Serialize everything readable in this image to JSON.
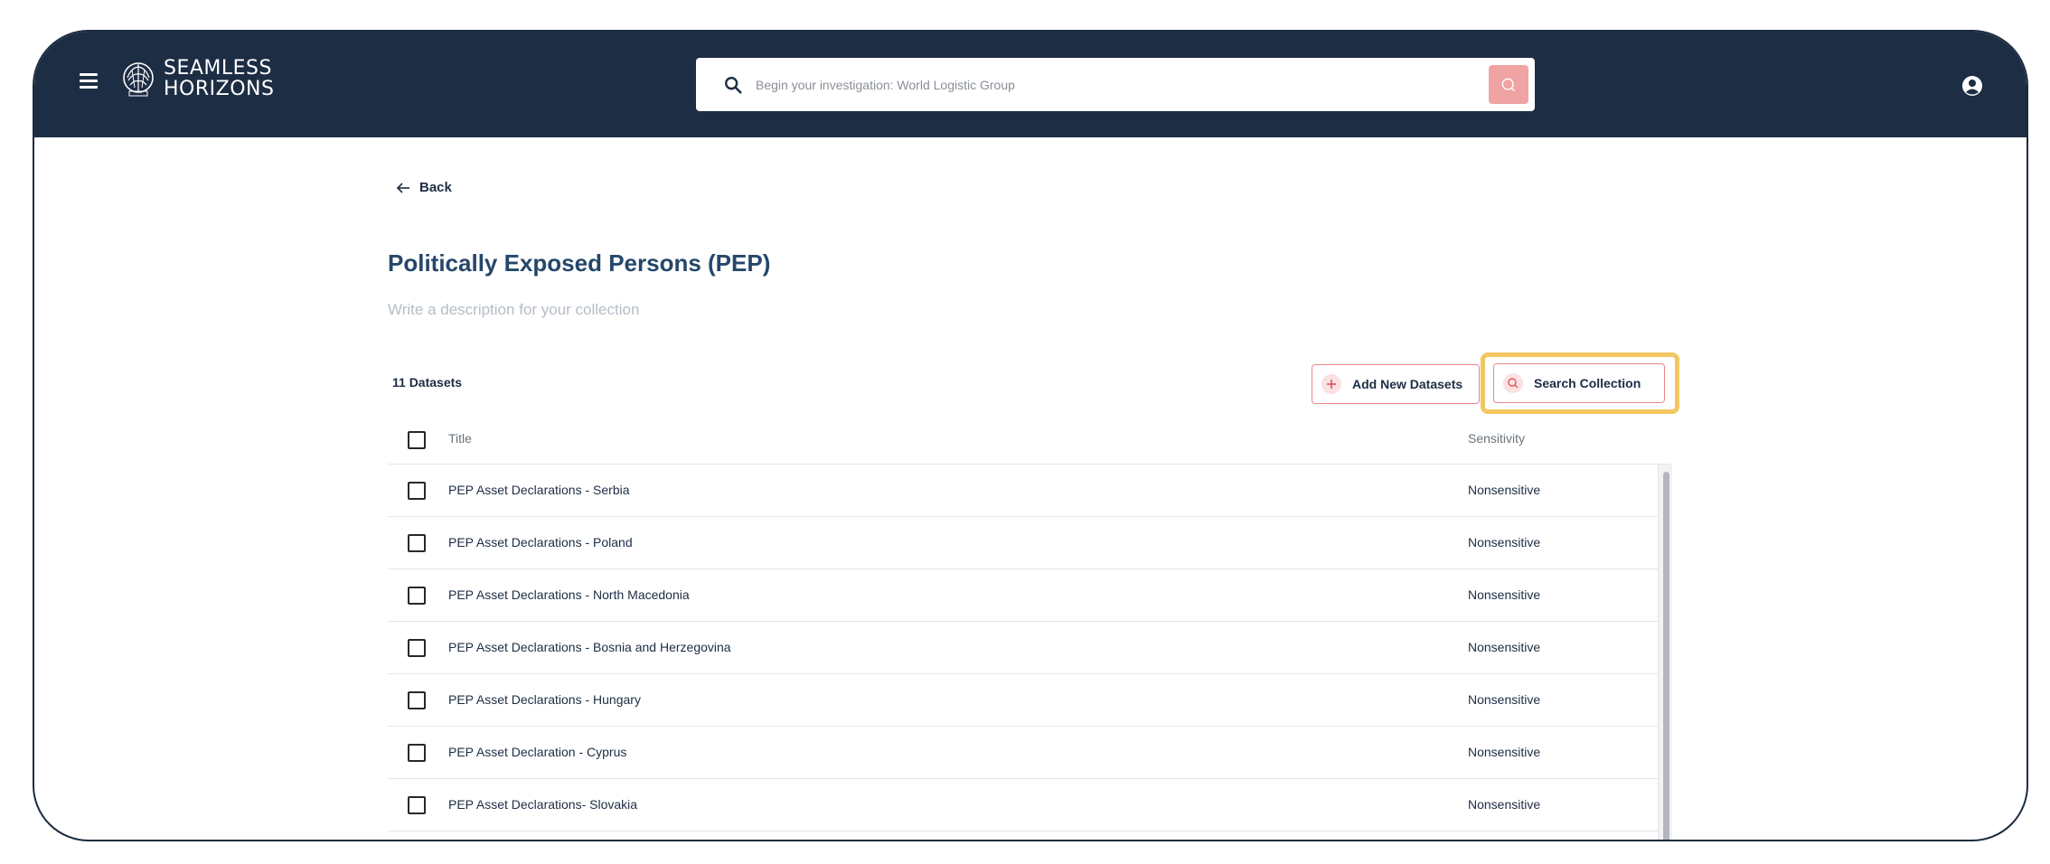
{
  "header": {
    "brand_line1": "SEAMLESS",
    "brand_line2": "HORIZONS",
    "search_placeholder": "Begin your investigation: World Logistic Group"
  },
  "page": {
    "back_label": "Back",
    "title": "Politically Exposed Persons (PEP)",
    "description_placeholder": "Write a description for your collection",
    "dataset_count": "11 Datasets",
    "add_button": "Add New Datasets",
    "search_button": "Search Collection"
  },
  "table": {
    "columns": [
      "Title",
      "Sensitivity"
    ],
    "rows": [
      {
        "title": "PEP Asset Declarations - Serbia",
        "sensitivity": "Nonsensitive"
      },
      {
        "title": "PEP Asset Declarations - Poland",
        "sensitivity": "Nonsensitive"
      },
      {
        "title": "PEP Asset Declarations - North Macedonia",
        "sensitivity": "Nonsensitive"
      },
      {
        "title": "PEP Asset Declarations - Bosnia and Herzegovina",
        "sensitivity": "Nonsensitive"
      },
      {
        "title": "PEP Asset Declarations - Hungary",
        "sensitivity": "Nonsensitive"
      },
      {
        "title": "PEP Asset Declaration - Cyprus",
        "sensitivity": "Nonsensitive"
      },
      {
        "title": "PEP Asset Declarations- Slovakia",
        "sensitivity": "Nonsensitive"
      }
    ]
  },
  "colors": {
    "header_bg": "#1d2d44",
    "title": "#25476a",
    "accent": "#e9878a",
    "highlight": "#f3c661"
  },
  "icons": [
    "menu-icon",
    "brain-logo-icon",
    "search-icon",
    "user-icon",
    "arrow-left-icon",
    "plus-icon",
    "checkbox-icon"
  ]
}
